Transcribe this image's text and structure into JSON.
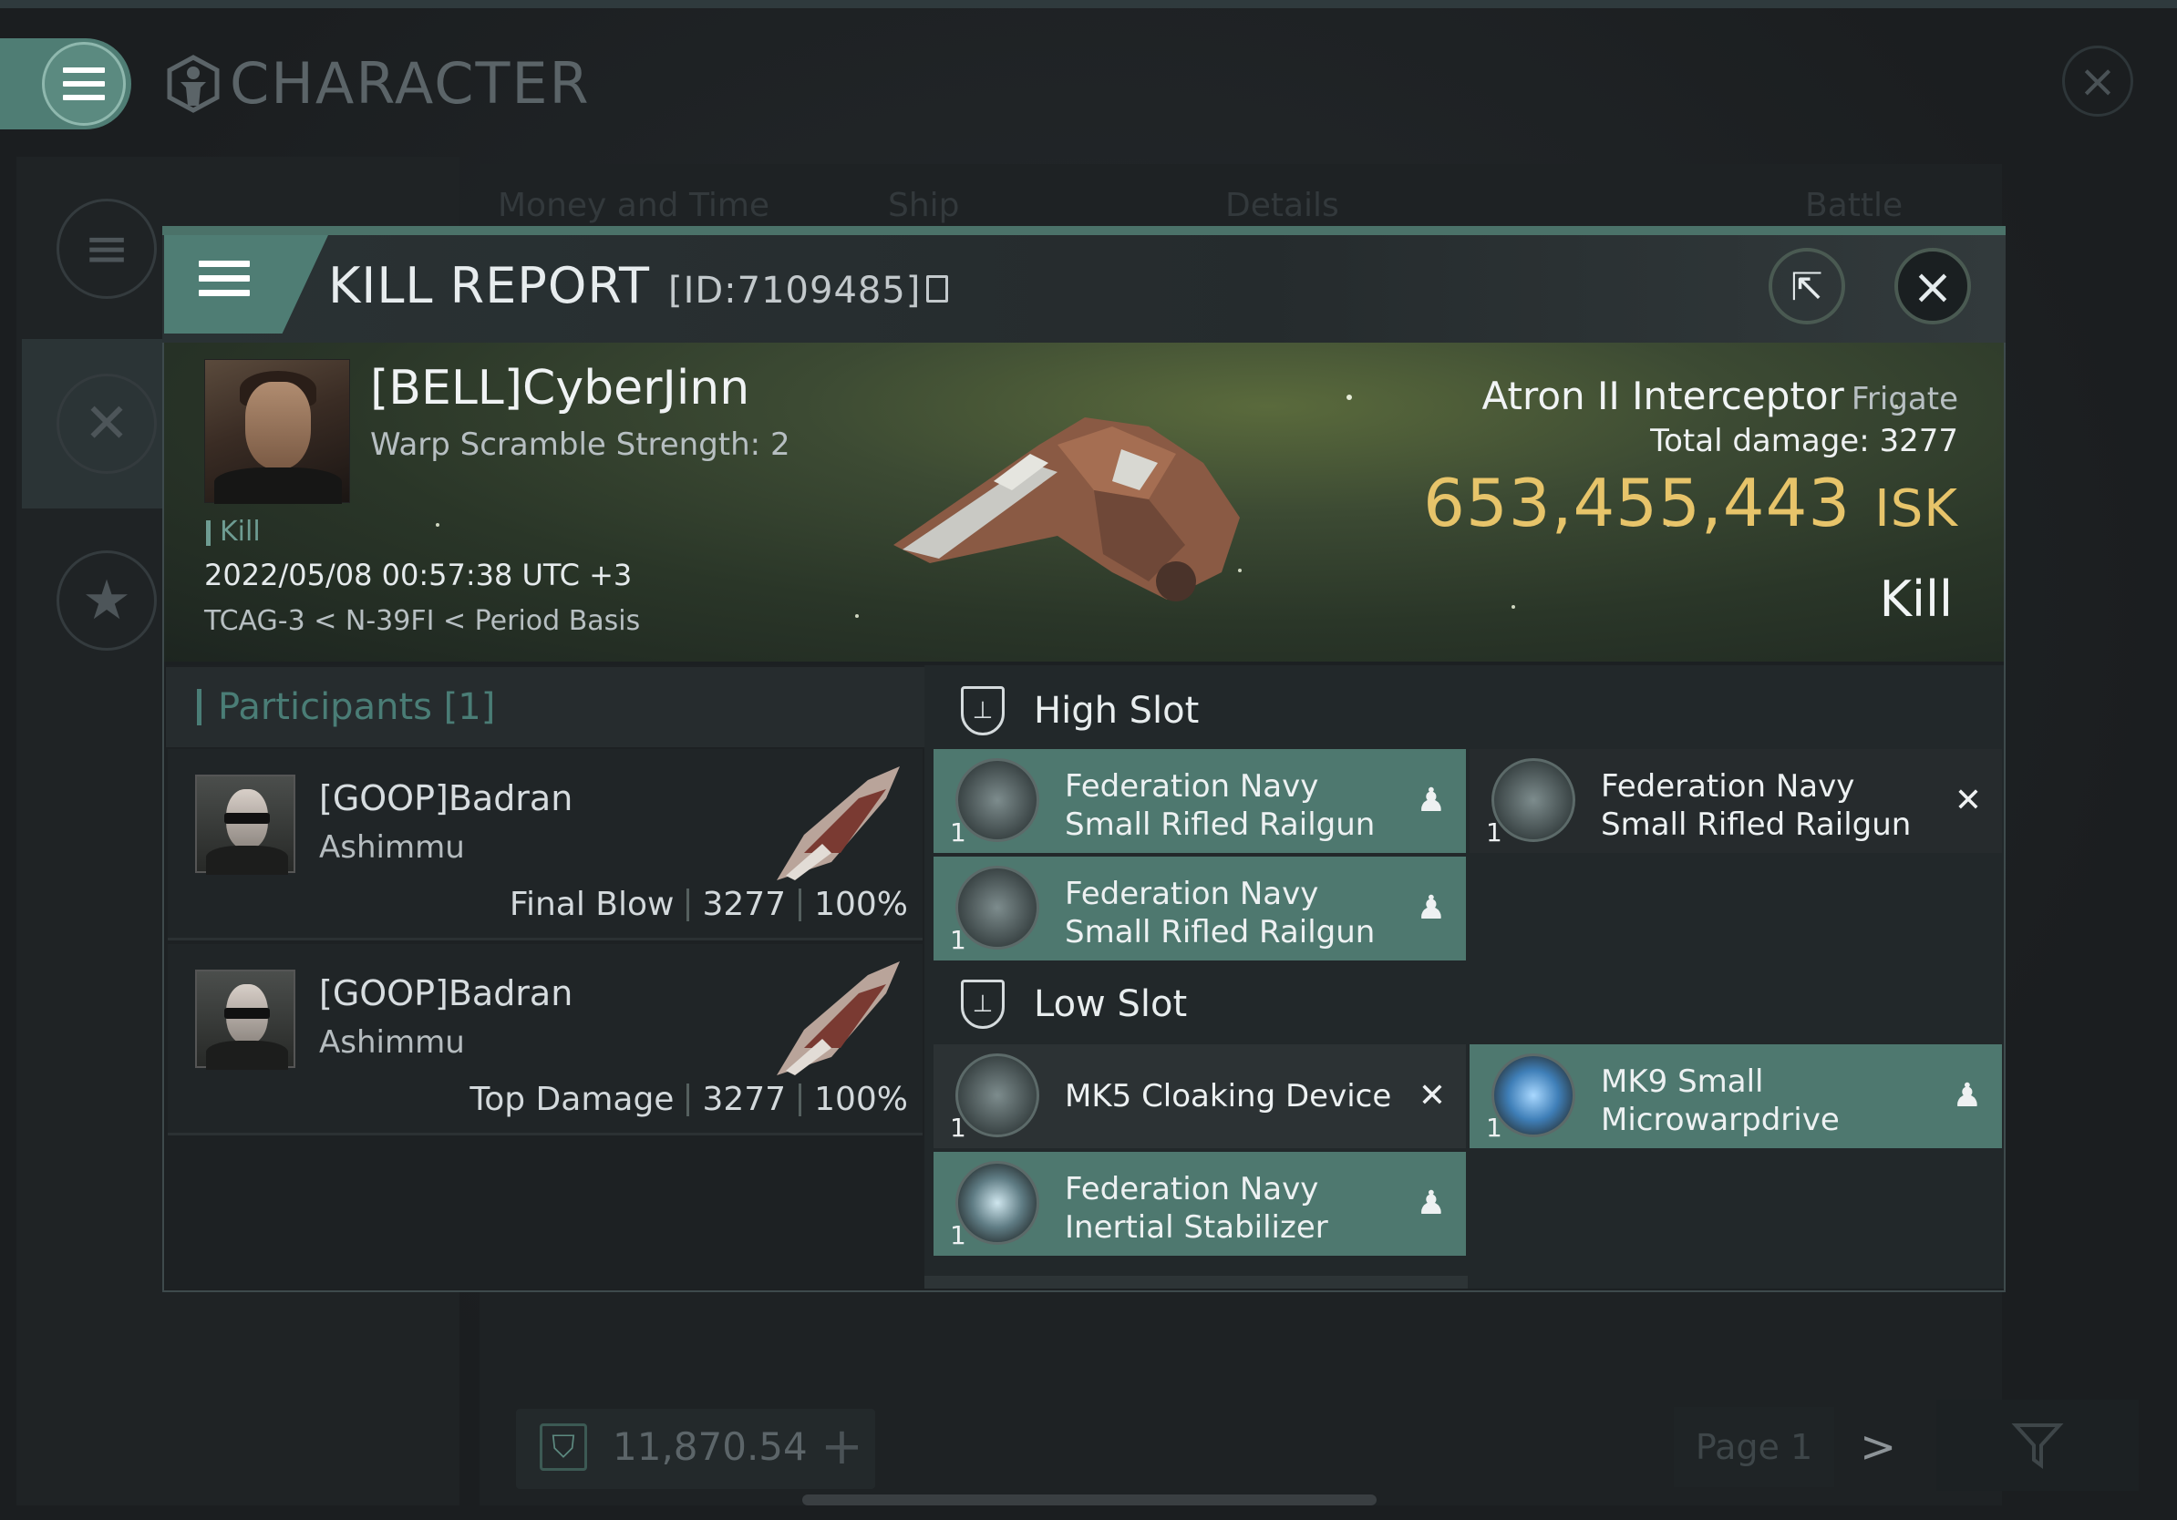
{
  "app": {
    "title": "CHARACTER"
  },
  "background": {
    "tabs": [
      "Money and Time",
      "Ship",
      "Details",
      "Battle Status"
    ],
    "wallet_value": "11,870.54",
    "page_label": "Page 1"
  },
  "window": {
    "title": "KILL REPORT",
    "id": "[ID:7109485]"
  },
  "victim": {
    "name": "[BELL]CyberJinn",
    "scram": "Warp Scramble Strength: 2",
    "tag": "Kill",
    "datetime": "2022/05/08 00:57:38 UTC +3",
    "location": "TCAG-3 < N-39FI < Period Basis",
    "ship_name": "Atron II Interceptor",
    "ship_class": "Frigate",
    "total_damage_label": "Total damage:",
    "total_damage": "3277",
    "isk_value": "653,455,443",
    "isk_unit": "ISK",
    "result": "Kill"
  },
  "participants": {
    "header": "Participants [1]",
    "rows": [
      {
        "name": "[GOOP]Badran",
        "ship": "Ashimmu",
        "label": "Final Blow",
        "damage": "3277",
        "percent": "100%"
      },
      {
        "name": "[GOOP]Badran",
        "ship": "Ashimmu",
        "label": "Top Damage",
        "damage": "3277",
        "percent": "100%"
      }
    ]
  },
  "slots": {
    "high_title": "High Slot",
    "low_title": "Low Slot",
    "high": [
      {
        "line1": "Federation Navy",
        "line2": "Small Rifled Railgun",
        "qty": "1",
        "state": "fitted"
      },
      {
        "line1": "Federation Navy",
        "line2": "Small Rifled Railgun",
        "qty": "1",
        "state": "destroyed"
      },
      {
        "line1": "Federation Navy",
        "line2": "Small Rifled Railgun",
        "qty": "1",
        "state": "fitted"
      }
    ],
    "low": [
      {
        "line1": "MK5 Cloaking Device",
        "line2": "",
        "qty": "1",
        "state": "destroyed"
      },
      {
        "line1": "MK9 Small",
        "line2": "Microwarpdrive",
        "qty": "1",
        "state": "fitted"
      },
      {
        "line1": "Federation Navy",
        "line2": "Inertial Stabilizer",
        "qty": "1",
        "state": "fitted"
      }
    ]
  },
  "colors": {
    "accent": "#4e786f",
    "isk": "#e7c46a"
  },
  "icons": [
    "menu-icon",
    "character-icon",
    "close-icon",
    "share-icon",
    "copy-icon",
    "shield-slot-icon",
    "pilot-icon",
    "x-icon",
    "filter-icon",
    "star-icon",
    "swords-icon"
  ]
}
